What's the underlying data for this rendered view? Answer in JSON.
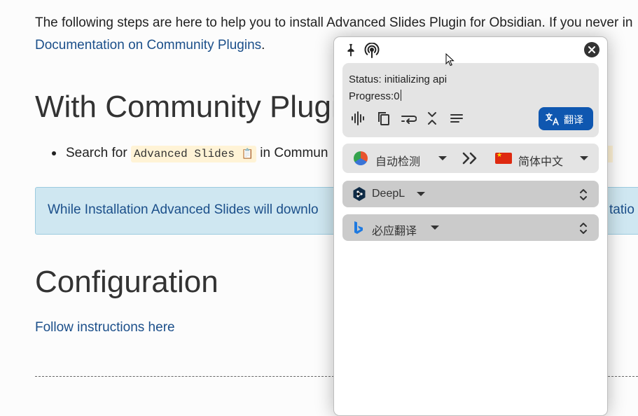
{
  "doc": {
    "intro_text": "The following steps are here to help you to install Advanced Slides Plugin for Obsidian. If you never in",
    "intro_link": "Documentation on Community Plugins",
    "intro_link_suffix": ".",
    "heading_community": "With Community Plugin",
    "bullet_prefix": "Search for ",
    "bullet_code": "Advanced Slides",
    "bullet_code_icon": "📋",
    "bullet_suffix": " in Commun",
    "info_text": "While Installation Advanced Slides will downlo",
    "info_text_tail": "tatio",
    "heading_configuration": "Configuration",
    "follow_link": "Follow instructions here"
  },
  "panel": {
    "status_line": "Status: initializing api",
    "progress_line": "Progress:0",
    "translate_button": "翻译",
    "source_language": "自动检测",
    "target_language": "简体中文",
    "engines": [
      {
        "name": "DeepL",
        "icon": "deepl-icon"
      },
      {
        "name": "必应翻译",
        "icon": "bing-icon"
      }
    ],
    "toolbar_icons": [
      "pin-icon",
      "broadcast-icon",
      "audio-wave-icon",
      "copy-icon",
      "wrap-icon",
      "collapse-icon",
      "align-icon"
    ]
  },
  "colors": {
    "link": "#1b4f8a",
    "info_bg": "#cfe7f1",
    "translate_button_bg": "#0f57b0",
    "panel_box_bg": "#e4e4e4",
    "engine_bg": "#cbcbcb"
  }
}
